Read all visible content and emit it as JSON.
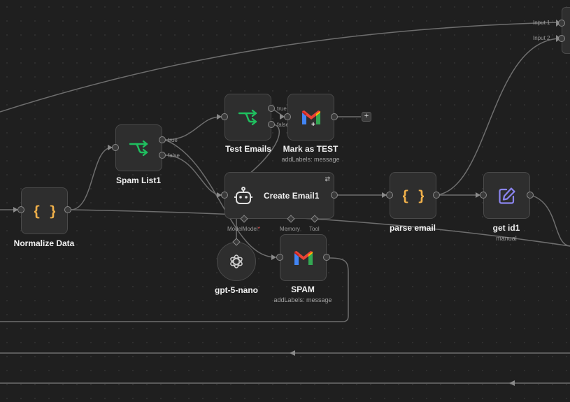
{
  "canvas": {
    "background": "#1f1f1f",
    "accent_colors": {
      "code": "#f0b04a",
      "switch": "#1fbf5f",
      "edit": "#8b85f0",
      "required": "#ff5a5a"
    }
  },
  "nodes": {
    "normalize": {
      "title": "Normalize Data",
      "icon": "curly-braces-icon"
    },
    "spam_list": {
      "title": "Spam List1",
      "icon": "switch-arrows-icon",
      "ports": {
        "true": "true",
        "false": "false"
      }
    },
    "test_emails": {
      "title": "Test Emails",
      "icon": "switch-arrows-icon",
      "ports": {
        "true": "true",
        "false": "false"
      }
    },
    "mark_test": {
      "title": "Mark as TEST",
      "subtitle": "addLabels: message",
      "icon": "gmail-icon"
    },
    "create_email": {
      "title": "Create Email1",
      "icon": "ai-agent-robot-icon",
      "ports": {
        "model": "Model",
        "model_dup": "Model",
        "required_mark": "*",
        "memory": "Memory",
        "tool": "Tool"
      }
    },
    "gpt": {
      "title": "gpt-5-nano",
      "icon": "openai-icon"
    },
    "spam": {
      "title": "SPAM",
      "subtitle": "addLabels: message",
      "icon": "gmail-icon"
    },
    "parse_email": {
      "title": "parse email",
      "icon": "curly-braces-icon"
    },
    "get_id": {
      "title": "get id1",
      "subtitle": "manual",
      "icon": "edit-pencil-icon"
    },
    "merge": {
      "inputs": [
        "Input 1",
        "Input 2"
      ]
    }
  },
  "add_button": "+"
}
